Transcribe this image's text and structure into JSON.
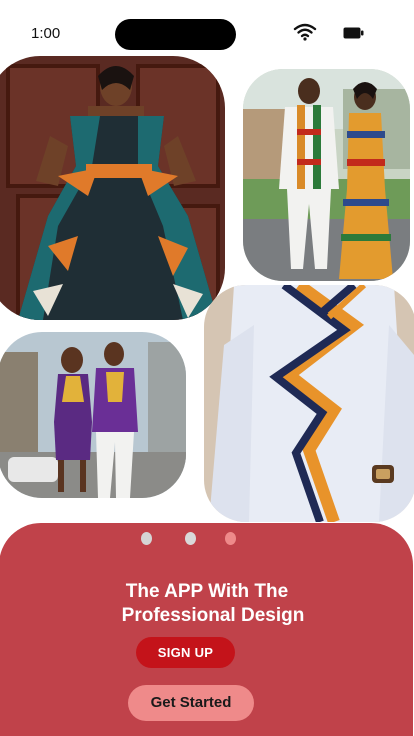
{
  "status_bar": {
    "time": "1:00",
    "wifi_icon": "wifi-icon",
    "battery_icon": "battery-icon"
  },
  "gallery": {
    "photos": [
      {
        "name": "woman-in-teal-ankara-dress",
        "alt": "Woman in teal and orange print dress"
      },
      {
        "name": "couple-in-kente-outfits",
        "alt": "Couple in kente print outfits"
      },
      {
        "name": "couple-in-purple-outfits",
        "alt": "Couple in purple print outfits"
      },
      {
        "name": "man-in-white-kaftan",
        "alt": "Man in white kaftan with striped pattern"
      }
    ]
  },
  "onboarding": {
    "page_indicator": {
      "count": 3,
      "active_index": 2
    },
    "headline_line1": "The APP With The",
    "headline_line2": "Professional Design",
    "signup_label": "SIGN UP",
    "get_started_label": "Get Started"
  },
  "colors": {
    "card": "#c0424a",
    "signup_button": "#c4131a",
    "get_started_button": "#ef8a8a",
    "dot_inactive": "#d5d5d5",
    "dot_active": "#ee8a8a"
  }
}
